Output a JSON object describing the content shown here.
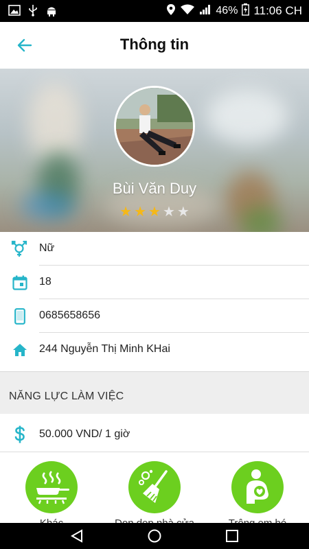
{
  "status_bar": {
    "battery": "46%",
    "time": "11:06 CH"
  },
  "app_bar": {
    "title": "Thông tin"
  },
  "profile": {
    "name": "Bùi Văn Duy",
    "rating": 3,
    "rating_max": 5
  },
  "info": {
    "gender": "Nữ",
    "age": "18",
    "phone": "0685658656",
    "address": "244 Nguyễn Thị Minh KHai"
  },
  "work": {
    "section_title": "NĂNG LỰC LÀM VIỆC",
    "rate": "50.000 VND/ 1 giờ"
  },
  "skills": [
    {
      "label": "Khác",
      "icon": "cooking-icon"
    },
    {
      "label": "Dọn dẹp nhà cửa",
      "icon": "broom-icon"
    },
    {
      "label": "Trông em bé",
      "icon": "baby-care-icon"
    }
  ],
  "colors": {
    "accent": "#26b5c9",
    "skill_green": "#6ccf1f",
    "star_on": "#f5b818",
    "star_off": "#e8e8e8"
  }
}
